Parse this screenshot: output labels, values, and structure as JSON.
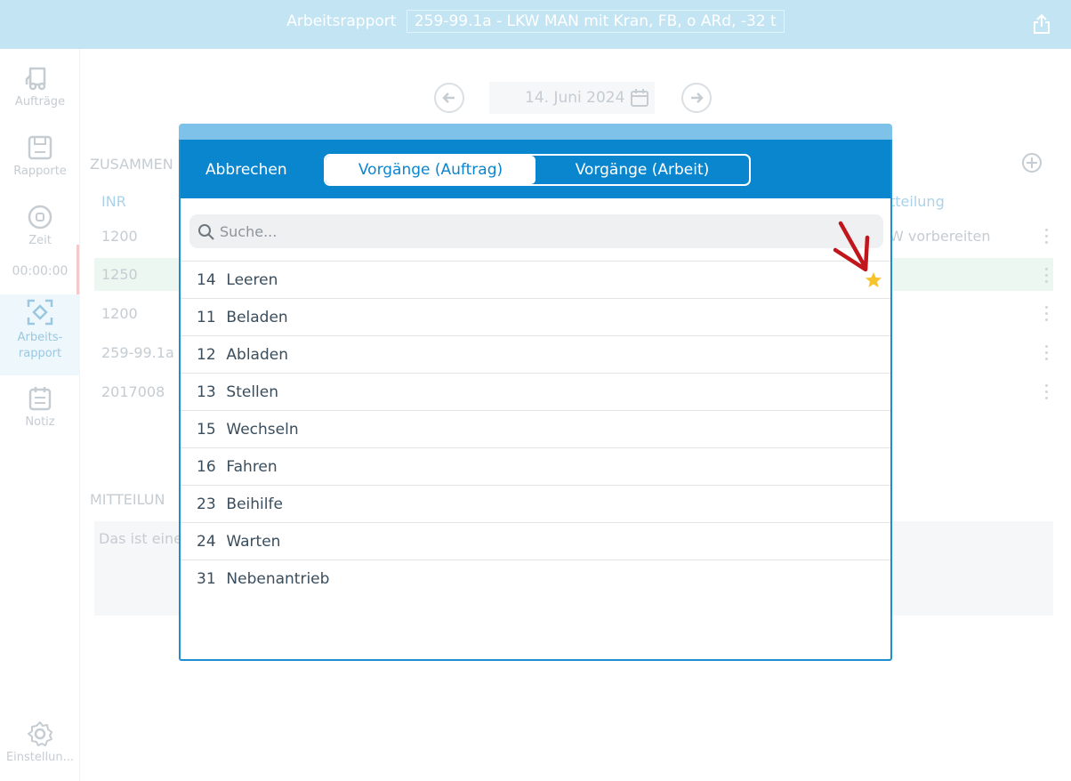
{
  "header": {
    "label": "Arbeitsrapport",
    "selection": "259-99.1a - LKW MAN mit Kran, FB, o ARd, -32 t"
  },
  "sidebar": {
    "items": [
      {
        "label": "Aufträge",
        "icon": "truck-icon"
      },
      {
        "label": "Rapporte",
        "icon": "floppy-icon"
      },
      {
        "label": "Zeit",
        "icon": "stop-icon"
      },
      {
        "label": "00:00:00"
      },
      {
        "label": "Arbeits-\nrapport",
        "icon": "scan-icon"
      },
      {
        "label": "Notiz",
        "icon": "notepad-icon"
      },
      {
        "label": "Einstellun...",
        "icon": "gear-icon"
      }
    ]
  },
  "date": "14. Juni 2024",
  "background": {
    "section_summary": "ZUSAMMEN",
    "col_inr": "INR",
    "col_message": "tteilung",
    "rows": [
      "1200",
      "1250",
      "1200",
      "259-99.1a",
      "2017008"
    ],
    "row1_message": "W vorbereiten",
    "section_message": "MITTEILUN",
    "message_text": "Das ist eine"
  },
  "modal": {
    "cancel_label": "Abbrechen",
    "tabs": [
      "Vorgänge (Auftrag)",
      "Vorgänge (Arbeit)"
    ],
    "search_placeholder": "Suche...",
    "items": [
      {
        "code": "14",
        "name": "Leeren",
        "favorite": true
      },
      {
        "code": "11",
        "name": "Beladen"
      },
      {
        "code": "12",
        "name": "Abladen"
      },
      {
        "code": "13",
        "name": "Stellen"
      },
      {
        "code": "15",
        "name": "Wechseln"
      },
      {
        "code": "16",
        "name": "Fahren"
      },
      {
        "code": "23",
        "name": "Beihilfe"
      },
      {
        "code": "24",
        "name": "Warten"
      },
      {
        "code": "31",
        "name": "Nebenantrieb"
      }
    ]
  },
  "colors": {
    "accent": "#0a86cf",
    "topbar": "#c3e4f3",
    "star": "#f6c32a",
    "arrow": "#c0161c"
  }
}
